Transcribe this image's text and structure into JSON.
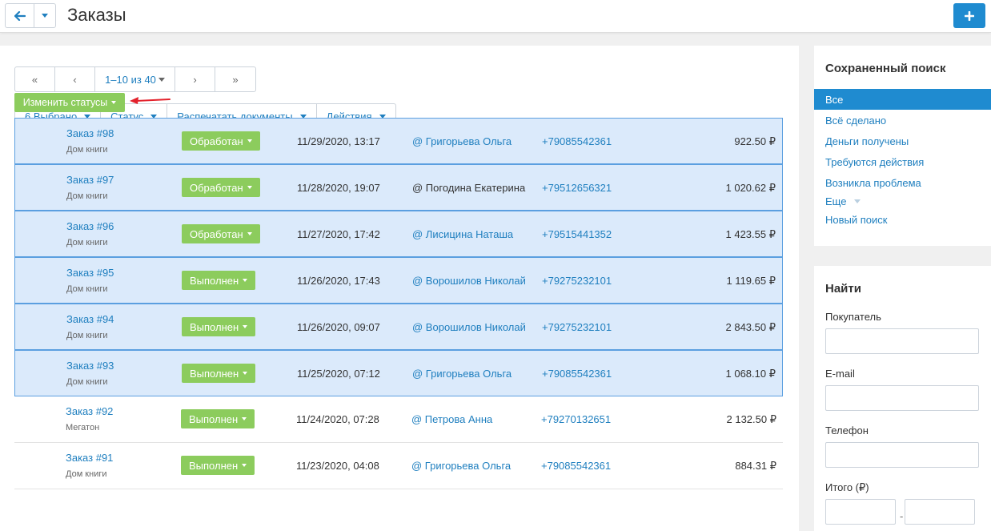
{
  "header": {
    "title": "Заказы",
    "accent": "#1f8bd0"
  },
  "pager": {
    "first": "«",
    "prev": "‹",
    "range": "1–10 из 40",
    "next": "›",
    "last": "»"
  },
  "toolbar": {
    "selected": "6 Выбрано",
    "status": "Статус",
    "print": "Распечатать документы",
    "actions": "Действия"
  },
  "change_status_label": "Изменить статусы",
  "orders": [
    {
      "order": "Заказ #98",
      "shop": "Дом книги",
      "status": "Обработан",
      "date": "11/29/2020, 13:17",
      "customer": "@ Григорьева Ольга",
      "customer_link": true,
      "phone": "+79085542361",
      "total": "922.50 ₽",
      "selected": true,
      "has_caret": true
    },
    {
      "order": "Заказ #97",
      "shop": "Дом книги",
      "status": "Обработан",
      "date": "11/28/2020, 19:07",
      "customer": "@ Погодина Екатерина",
      "customer_link": false,
      "phone": "+79512656321",
      "total": "1 020.62 ₽",
      "selected": true,
      "has_caret": true
    },
    {
      "order": "Заказ #96",
      "shop": "Дом книги",
      "status": "Обработан",
      "date": "11/27/2020, 17:42",
      "customer": "@ Лисицина Наташа",
      "customer_link": true,
      "phone": "+79515441352",
      "total": "1 423.55 ₽",
      "selected": true,
      "has_caret": true
    },
    {
      "order": "Заказ #95",
      "shop": "Дом книги",
      "status": "Выполнен",
      "date": "11/26/2020, 17:43",
      "customer": "@ Ворошилов Николай",
      "customer_link": true,
      "phone": "+79275232101",
      "total": "1 119.65 ₽",
      "selected": true,
      "has_caret": true
    },
    {
      "order": "Заказ #94",
      "shop": "Дом книги",
      "status": "Выполнен",
      "date": "11/26/2020, 09:07",
      "customer": "@ Ворошилов Николай",
      "customer_link": true,
      "phone": "+79275232101",
      "total": "2 843.50 ₽",
      "selected": true,
      "has_caret": true
    },
    {
      "order": "Заказ #93",
      "shop": "Дом книги",
      "status": "Выполнен",
      "date": "11/25/2020, 07:12",
      "customer": "@ Григорьева Ольга",
      "customer_link": true,
      "phone": "+79085542361",
      "total": "1 068.10 ₽",
      "selected": true,
      "has_caret": true
    },
    {
      "order": "Заказ #92",
      "shop": "Мегатон",
      "status": "Выполнен",
      "date": "11/24/2020, 07:28",
      "customer": "@ Петрова Анна",
      "customer_link": true,
      "phone": "+79270132651",
      "total": "2 132.50 ₽",
      "selected": false,
      "has_caret": true
    },
    {
      "order": "Заказ #91",
      "shop": "Дом книги",
      "status": "Выполнен",
      "date": "11/23/2020, 04:08",
      "customer": "@ Григорьева Ольга",
      "customer_link": true,
      "phone": "+79085542361",
      "total": "884.31 ₽",
      "selected": false,
      "has_caret": true
    }
  ],
  "saved_search": {
    "title": "Сохраненный поиск",
    "items": [
      "Все",
      "Всё сделано",
      "Деньги получены",
      "Требуются действия",
      "Возникла проблема",
      "Еще",
      "Новый поиск"
    ],
    "active_index": 0
  },
  "find": {
    "title": "Найти",
    "buyer_label": "Покупатель",
    "email_label": "E-mail",
    "phone_label": "Телефон",
    "total_label": "Итого (₽)",
    "dash": "-"
  }
}
